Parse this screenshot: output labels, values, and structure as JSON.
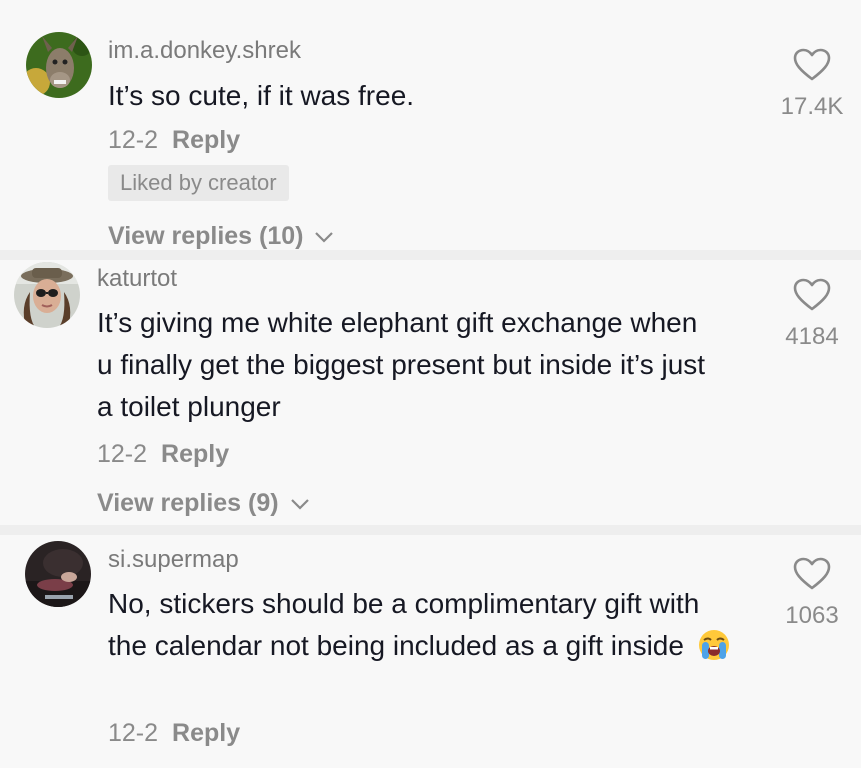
{
  "comments": [
    {
      "username": "im.a.donkey.shrek",
      "text": "It’s so cute, if it was free.",
      "date": "12-2",
      "reply_label": "Reply",
      "badge": "Liked by creator",
      "view_replies": "View replies (10)",
      "likes": "17.4K",
      "avatar_icon": "donkey-avatar"
    },
    {
      "username": "katurtot",
      "text": "It’s giving me white elephant gift exchange when u finally get the biggest present but inside it’s just a toilet plunger",
      "date": "12-2",
      "reply_label": "Reply",
      "view_replies": "View replies (9)",
      "likes": "4184",
      "avatar_icon": "user-photo-avatar"
    },
    {
      "username": "si.supermap",
      "text": "No, stickers should be a complimentary gift with the calendar not being included as a gift inside",
      "emoji": "loudly-crying-face",
      "date": "12-2",
      "reply_label": "Reply",
      "likes": "1063",
      "avatar_icon": "user-photo-avatar"
    }
  ],
  "colors": {
    "background": "#f8f8f8",
    "separator": "#eeeeee",
    "text": "#161823",
    "muted": "#8a8a8a",
    "badge_bg": "#e9e9e9"
  }
}
